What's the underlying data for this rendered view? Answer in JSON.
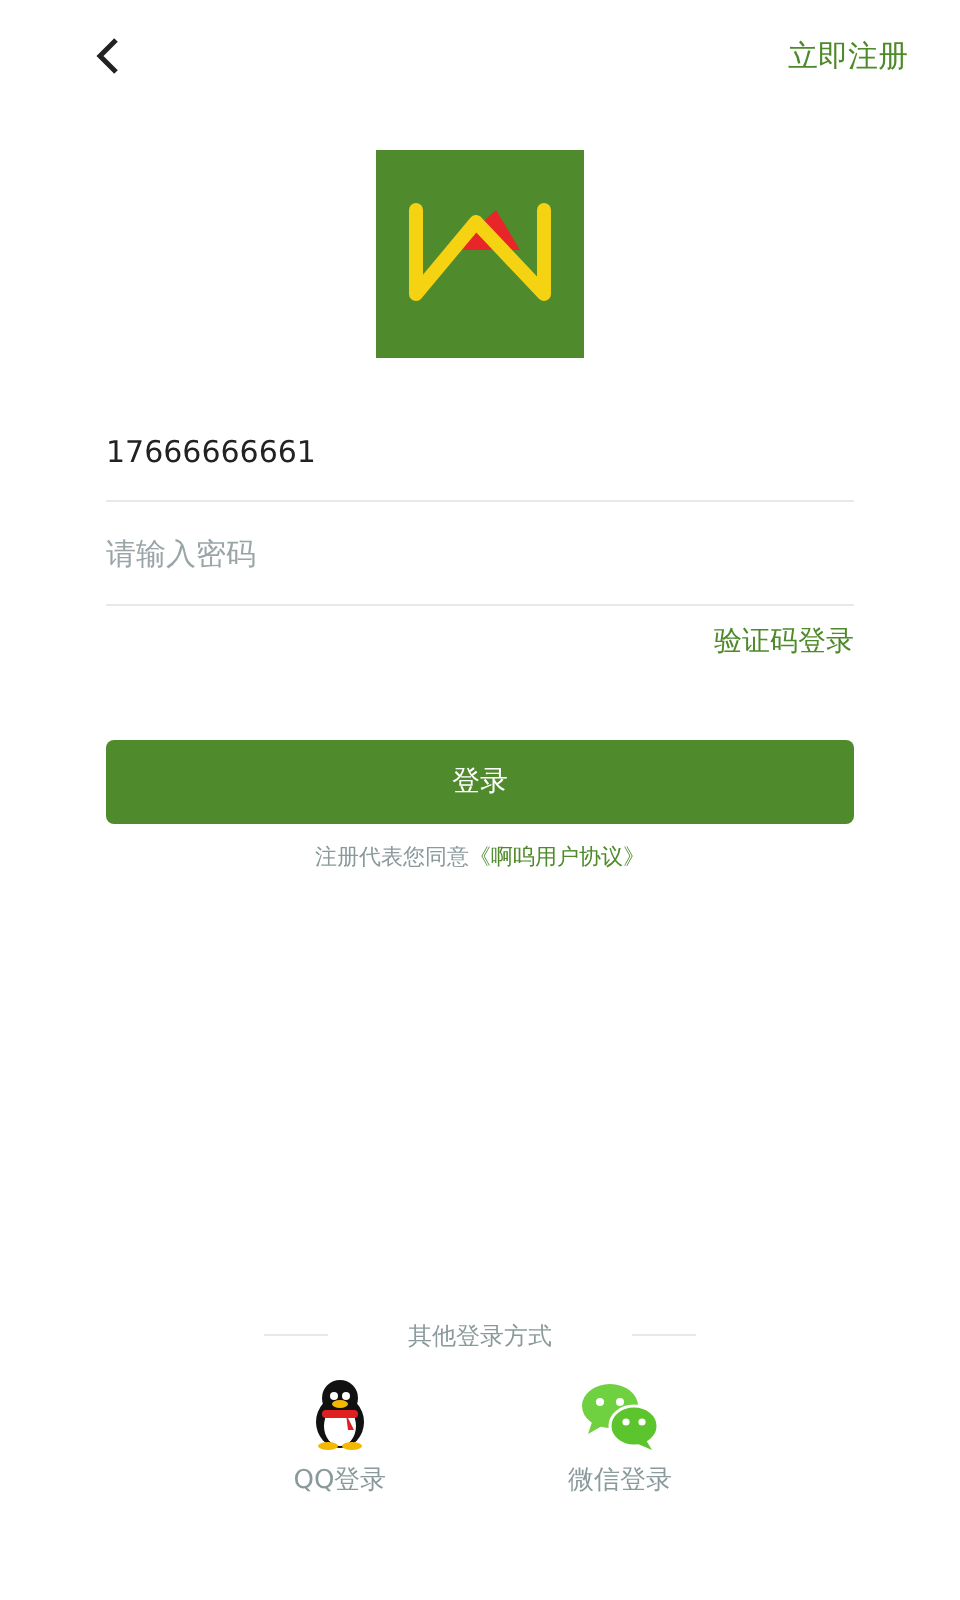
{
  "header": {
    "action": "立即注册"
  },
  "form": {
    "phone": {
      "value": "17666666661"
    },
    "password": {
      "placeholder": "请输入密码"
    },
    "alt_login": "验证码登录",
    "submit": "登录"
  },
  "agreement": {
    "prefix": "注册代表您同意",
    "link": "《啊呜用户协议》"
  },
  "other_login": {
    "title": "其他登录方式",
    "methods": [
      {
        "kind": "qq",
        "label": "QQ登录"
      },
      {
        "kind": "wechat",
        "label": "微信登录"
      }
    ]
  }
}
